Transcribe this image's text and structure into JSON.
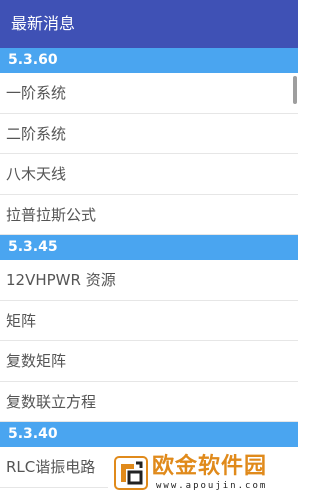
{
  "header": {
    "title": "最新消息"
  },
  "sections": [
    {
      "version": "5.3.60",
      "items": [
        "一阶系统",
        "二阶系统",
        "八木天线",
        "拉普拉斯公式"
      ]
    },
    {
      "version": "5.3.45",
      "items": [
        "12VHPWR 资源",
        "矩阵",
        "复数矩阵",
        "复数联立方程"
      ]
    },
    {
      "version": "5.3.40",
      "items": [
        "RLC谐振电路"
      ]
    }
  ],
  "watermark": {
    "title": "欧金软件园",
    "subtitle": "www.apoujin.com"
  },
  "colors": {
    "titlebar": "#3f51b5",
    "section": "#4aa5f0",
    "watermark": "#e08a1b"
  }
}
